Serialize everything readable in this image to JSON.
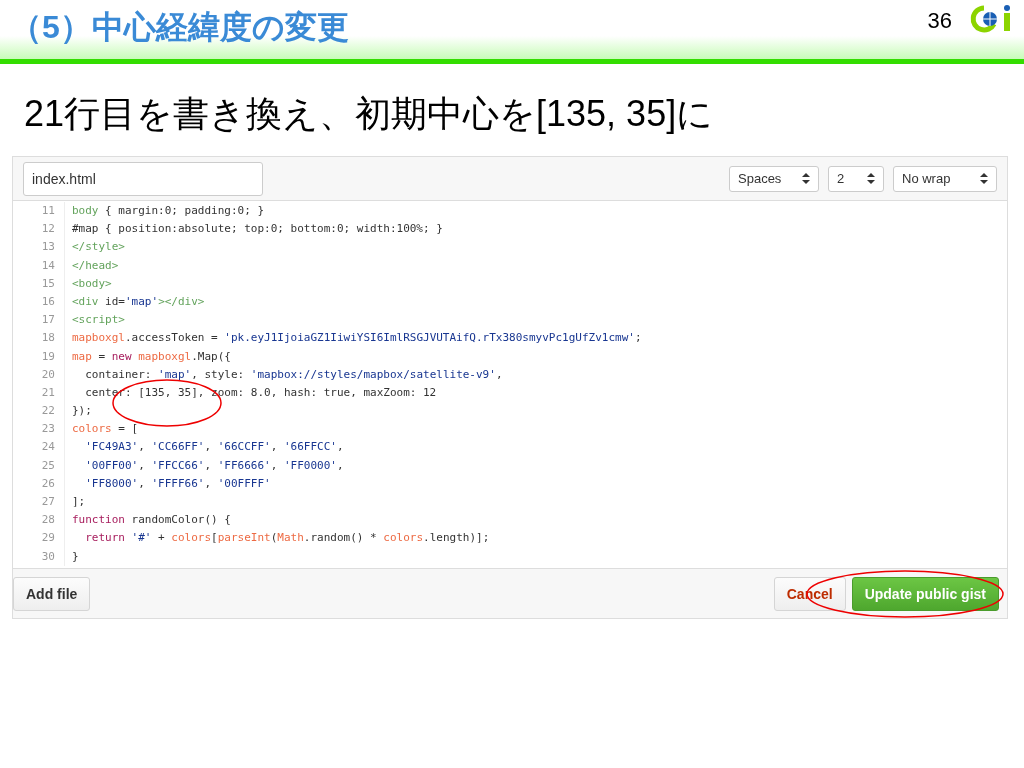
{
  "slide": {
    "title": "（5）中心経緯度の変更",
    "page_number": "36",
    "subtitle": "21行目を書き換え、初期中心を[135, 35]に"
  },
  "editor": {
    "filename": "index.html",
    "selects": [
      {
        "value": "Spaces"
      },
      {
        "value": "2"
      },
      {
        "value": "No wrap"
      }
    ],
    "lines": [
      {
        "number": "11",
        "tokens": [
          {
            "kind": "tag",
            "text": "body"
          },
          {
            "kind": "plain",
            "text": " { margin:0; padding:0; }"
          }
        ]
      },
      {
        "number": "12",
        "tokens": [
          {
            "kind": "plain",
            "text": "#map { position:absolute; top:0; bottom:0; width:100%; }"
          }
        ]
      },
      {
        "number": "13",
        "tokens": [
          {
            "kind": "tag",
            "text": "</style>"
          }
        ]
      },
      {
        "number": "14",
        "tokens": [
          {
            "kind": "tag",
            "text": "</head>"
          }
        ]
      },
      {
        "number": "15",
        "tokens": [
          {
            "kind": "tag",
            "text": "<body>"
          }
        ]
      },
      {
        "number": "16",
        "tokens": [
          {
            "kind": "tag",
            "text": "<div"
          },
          {
            "kind": "plain",
            "text": " id="
          },
          {
            "kind": "string",
            "text": "'map'"
          },
          {
            "kind": "tag",
            "text": "></div>"
          }
        ]
      },
      {
        "number": "17",
        "tokens": [
          {
            "kind": "tag",
            "text": "<script>"
          }
        ]
      },
      {
        "number": "18",
        "tokens": [
          {
            "kind": "var",
            "text": "mapboxgl"
          },
          {
            "kind": "plain",
            "text": ".accessToken = "
          },
          {
            "kind": "string",
            "text": "'pk.eyJ1IjoiaGZ1IiwiYSI6ImlRSGJVUTAifQ.rTx380smyvPc1gUfZv1cmw'"
          },
          {
            "kind": "plain",
            "text": ";"
          }
        ]
      },
      {
        "number": "19",
        "tokens": [
          {
            "kind": "var",
            "text": "map"
          },
          {
            "kind": "plain",
            "text": " = "
          },
          {
            "kind": "keyword",
            "text": "new "
          },
          {
            "kind": "var",
            "text": "mapboxgl"
          },
          {
            "kind": "plain",
            "text": ".Map({"
          }
        ]
      },
      {
        "number": "20",
        "tokens": [
          {
            "kind": "plain",
            "text": "  container: "
          },
          {
            "kind": "string",
            "text": "'map'"
          },
          {
            "kind": "plain",
            "text": ", style: "
          },
          {
            "kind": "string",
            "text": "'mapbox://styles/mapbox/satellite-v9'"
          },
          {
            "kind": "plain",
            "text": ","
          }
        ]
      },
      {
        "number": "21",
        "tokens": [
          {
            "kind": "plain",
            "text": "  center: [135, 35], zoom: 8.0, hash: true, maxZoom: 12"
          }
        ]
      },
      {
        "number": "22",
        "tokens": [
          {
            "kind": "plain",
            "text": "});"
          }
        ]
      },
      {
        "number": "23",
        "tokens": [
          {
            "kind": "var",
            "text": "colors"
          },
          {
            "kind": "plain",
            "text": " = ["
          }
        ]
      },
      {
        "number": "24",
        "tokens": [
          {
            "kind": "string",
            "text": "  'FC49A3'"
          },
          {
            "kind": "plain",
            "text": ", "
          },
          {
            "kind": "string",
            "text": "'CC66FF'"
          },
          {
            "kind": "plain",
            "text": ", "
          },
          {
            "kind": "string",
            "text": "'66CCFF'"
          },
          {
            "kind": "plain",
            "text": ", "
          },
          {
            "kind": "string",
            "text": "'66FFCC'"
          },
          {
            "kind": "plain",
            "text": ","
          }
        ]
      },
      {
        "number": "25",
        "tokens": [
          {
            "kind": "string",
            "text": "  '00FF00'"
          },
          {
            "kind": "plain",
            "text": ", "
          },
          {
            "kind": "string",
            "text": "'FFCC66'"
          },
          {
            "kind": "plain",
            "text": ", "
          },
          {
            "kind": "string",
            "text": "'FF6666'"
          },
          {
            "kind": "plain",
            "text": ", "
          },
          {
            "kind": "string",
            "text": "'FF0000'"
          },
          {
            "kind": "plain",
            "text": ","
          }
        ]
      },
      {
        "number": "26",
        "tokens": [
          {
            "kind": "string",
            "text": "  'FF8000'"
          },
          {
            "kind": "plain",
            "text": ", "
          },
          {
            "kind": "string",
            "text": "'FFFF66'"
          },
          {
            "kind": "plain",
            "text": ", "
          },
          {
            "kind": "string",
            "text": "'00FFFF'"
          }
        ]
      },
      {
        "number": "27",
        "tokens": [
          {
            "kind": "plain",
            "text": "];"
          }
        ]
      },
      {
        "number": "28",
        "tokens": [
          {
            "kind": "keyword",
            "text": "function"
          },
          {
            "kind": "plain",
            "text": " randomColor() {"
          }
        ]
      },
      {
        "number": "29",
        "tokens": [
          {
            "kind": "keyword",
            "text": "  return "
          },
          {
            "kind": "string",
            "text": "'#'"
          },
          {
            "kind": "plain",
            "text": " + "
          },
          {
            "kind": "var",
            "text": "colors"
          },
          {
            "kind": "plain",
            "text": "["
          },
          {
            "kind": "var",
            "text": "parseInt"
          },
          {
            "kind": "plain",
            "text": "("
          },
          {
            "kind": "var",
            "text": "Math"
          },
          {
            "kind": "plain",
            "text": ".random() * "
          },
          {
            "kind": "var",
            "text": "colors"
          },
          {
            "kind": "plain",
            "text": ".length)];"
          }
        ]
      },
      {
        "number": "30",
        "tokens": [
          {
            "kind": "plain",
            "text": "}"
          }
        ]
      }
    ]
  },
  "actions": {
    "add_file": "Add file",
    "cancel": "Cancel",
    "submit": "Update public gist"
  }
}
